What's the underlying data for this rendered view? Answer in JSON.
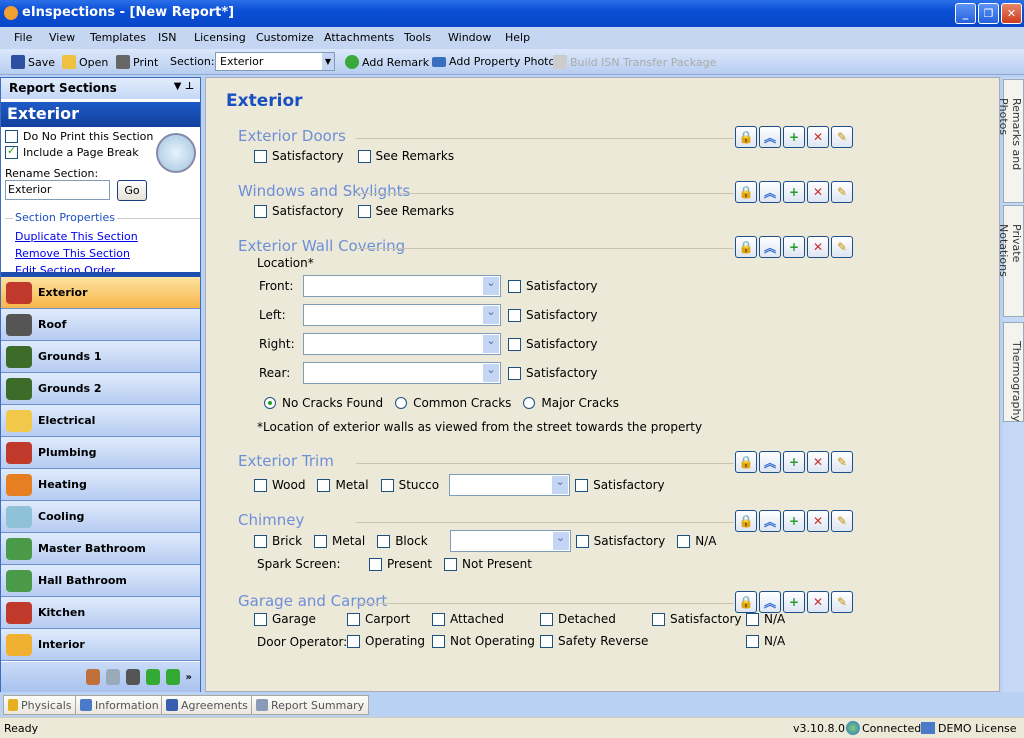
{
  "window": {
    "title": "eInspections - [New Report*]"
  },
  "menu": [
    "File",
    "View",
    "Templates",
    "ISN",
    "Licensing",
    "Customize",
    "Attachments",
    "Tools",
    "Window",
    "Help"
  ],
  "toolbar": {
    "save": "Save",
    "open": "Open",
    "print": "Print",
    "section_label": "Section:",
    "section_value": "Exterior",
    "add_remark": "Add Remark",
    "add_photo": "Add Property Photo",
    "build_isn": "Build ISN Transfer Package"
  },
  "left_panel": {
    "title": "Report Sections",
    "section_name": "Exterior",
    "do_not_print": "Do No Print this Section",
    "do_not_print_checked": false,
    "page_break": "Include a Page Break",
    "page_break_checked": true,
    "rename_label": "Rename Section:",
    "rename_value": "Exterior",
    "go": "Go",
    "properties_label": "Section Properties",
    "links": [
      "Duplicate This Section",
      "Remove This Section",
      "Edit Section Order"
    ],
    "nav": [
      {
        "label": "Exterior",
        "color": "#c0392b"
      },
      {
        "label": "Roof",
        "color": "#555555"
      },
      {
        "label": "Grounds 1",
        "color": "#3d6b2a"
      },
      {
        "label": "Grounds 2",
        "color": "#3d6b2a"
      },
      {
        "label": "Electrical",
        "color": "#f2c84b"
      },
      {
        "label": "Plumbing",
        "color": "#c0392b"
      },
      {
        "label": "Heating",
        "color": "#e67e22"
      },
      {
        "label": "Cooling",
        "color": "#8fc1d9"
      },
      {
        "label": "Master Bathroom",
        "color": "#4a9a4a"
      },
      {
        "label": "Hall Bathroom",
        "color": "#4a9a4a"
      },
      {
        "label": "Kitchen",
        "color": "#c0392b"
      },
      {
        "label": "Interior",
        "color": "#f0b030"
      }
    ],
    "active": "Exterior"
  },
  "main": {
    "title": "Exterior",
    "exterior_doors": {
      "title": "Exterior Doors",
      "options": [
        "Satisfactory",
        "See Remarks"
      ]
    },
    "windows": {
      "title": "Windows and Skylights",
      "options": [
        "Satisfactory",
        "See Remarks"
      ]
    },
    "wall": {
      "title": "Exterior Wall Covering",
      "location_label": "Location*",
      "rows": [
        "Front:",
        "Left:",
        "Right:",
        "Rear:"
      ],
      "satisfactory": "Satisfactory",
      "radios": [
        "No Cracks Found",
        "Common Cracks",
        "Major Cracks"
      ],
      "radio_selected": "No Cracks Found",
      "note": "*Location of exterior walls as viewed from the street towards the property"
    },
    "trim": {
      "title": "Exterior Trim",
      "options": [
        "Wood",
        "Metal",
        "Stucco"
      ],
      "satisfactory": "Satisfactory"
    },
    "chimney": {
      "title": "Chimney",
      "options": [
        "Brick",
        "Metal",
        "Block"
      ],
      "satisfactory": "Satisfactory",
      "na": "N/A",
      "spark_label": "Spark Screen:",
      "spark_options": [
        "Present",
        "Not Present"
      ]
    },
    "garage": {
      "title": "Garage and Carport",
      "options": [
        "Garage",
        "Carport",
        "Attached",
        "Detached",
        "Satisfactory",
        "N/A"
      ],
      "door_label": "Door Operator:",
      "door_options": [
        "Operating",
        "Not Operating",
        "Safety Reverse",
        "N/A"
      ]
    }
  },
  "right_tabs": [
    "Remarks and Photos",
    "Private Notations",
    "Thermography"
  ],
  "bottom_tabs": [
    "Physicals",
    "Information",
    "Agreements",
    "Report Summary"
  ],
  "status": {
    "text": "Ready",
    "version": "v3.10.8.0",
    "connection": "Connected",
    "license": "DEMO License"
  }
}
